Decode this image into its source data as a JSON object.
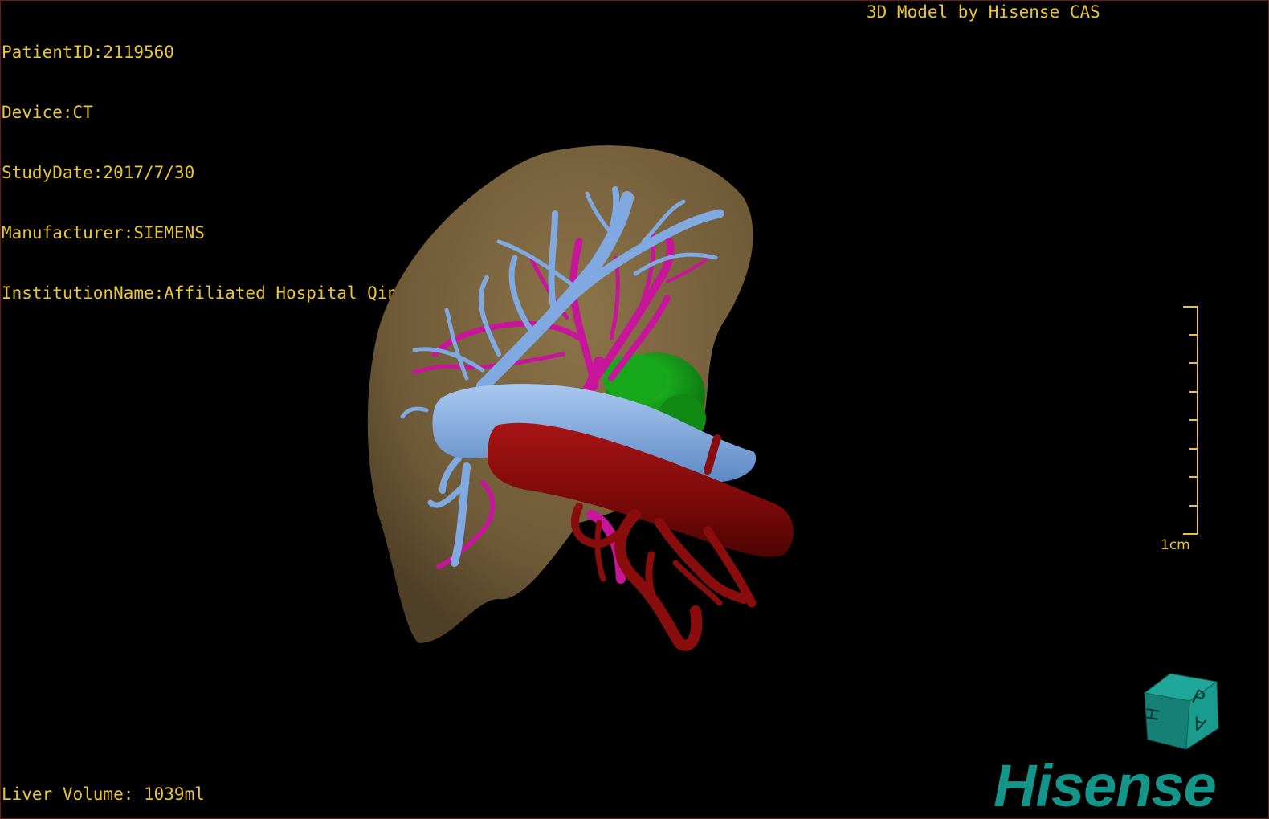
{
  "overlay": {
    "patient_id": "PatientID:2119560",
    "device": "Device:CT",
    "study_date": "StudyDate:2017/7/30",
    "manufacturer": "Manufacturer:SIEMENS",
    "institution": "InstitutionName:Affiliated Hospital Qingdao University-C",
    "title": "3D Model by Hisense CAS",
    "liver_volume": "Liver Volume: 1039ml"
  },
  "scale": {
    "label": "1cm"
  },
  "orientation_cube": {
    "face_top": "P",
    "face_left": "H",
    "face_right": "A"
  },
  "brand": {
    "logo_text": "Hisense"
  },
  "colors": {
    "overlay_text": "#e8c531",
    "liver": "#7a6440",
    "portal_vein": "#7fa9e0",
    "hepatic_artery": "#c8159b",
    "aorta": "#8a0d0d",
    "tumor": "#139a16",
    "brand": "#14958a"
  }
}
